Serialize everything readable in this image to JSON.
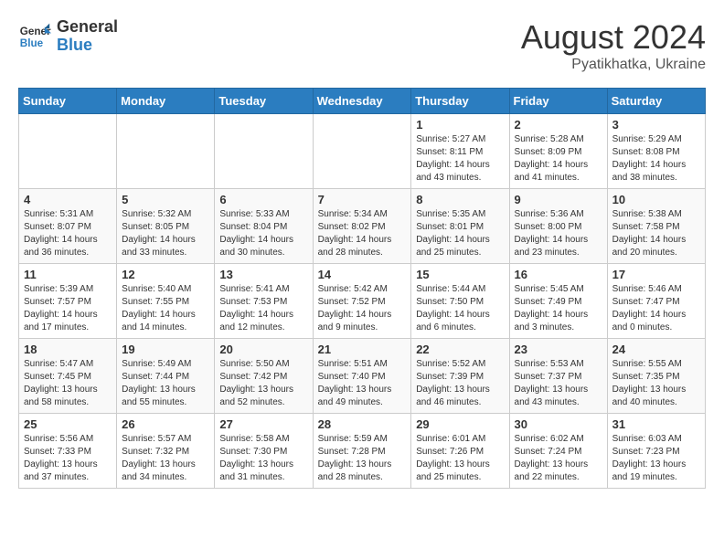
{
  "header": {
    "logo_general": "General",
    "logo_blue": "Blue",
    "month_year": "August 2024",
    "location": "Pyatikhatka, Ukraine"
  },
  "weekdays": [
    "Sunday",
    "Monday",
    "Tuesday",
    "Wednesday",
    "Thursday",
    "Friday",
    "Saturday"
  ],
  "weeks": [
    [
      {
        "day": "",
        "info": ""
      },
      {
        "day": "",
        "info": ""
      },
      {
        "day": "",
        "info": ""
      },
      {
        "day": "",
        "info": ""
      },
      {
        "day": "1",
        "info": "Sunrise: 5:27 AM\nSunset: 8:11 PM\nDaylight: 14 hours\nand 43 minutes."
      },
      {
        "day": "2",
        "info": "Sunrise: 5:28 AM\nSunset: 8:09 PM\nDaylight: 14 hours\nand 41 minutes."
      },
      {
        "day": "3",
        "info": "Sunrise: 5:29 AM\nSunset: 8:08 PM\nDaylight: 14 hours\nand 38 minutes."
      }
    ],
    [
      {
        "day": "4",
        "info": "Sunrise: 5:31 AM\nSunset: 8:07 PM\nDaylight: 14 hours\nand 36 minutes."
      },
      {
        "day": "5",
        "info": "Sunrise: 5:32 AM\nSunset: 8:05 PM\nDaylight: 14 hours\nand 33 minutes."
      },
      {
        "day": "6",
        "info": "Sunrise: 5:33 AM\nSunset: 8:04 PM\nDaylight: 14 hours\nand 30 minutes."
      },
      {
        "day": "7",
        "info": "Sunrise: 5:34 AM\nSunset: 8:02 PM\nDaylight: 14 hours\nand 28 minutes."
      },
      {
        "day": "8",
        "info": "Sunrise: 5:35 AM\nSunset: 8:01 PM\nDaylight: 14 hours\nand 25 minutes."
      },
      {
        "day": "9",
        "info": "Sunrise: 5:36 AM\nSunset: 8:00 PM\nDaylight: 14 hours\nand 23 minutes."
      },
      {
        "day": "10",
        "info": "Sunrise: 5:38 AM\nSunset: 7:58 PM\nDaylight: 14 hours\nand 20 minutes."
      }
    ],
    [
      {
        "day": "11",
        "info": "Sunrise: 5:39 AM\nSunset: 7:57 PM\nDaylight: 14 hours\nand 17 minutes."
      },
      {
        "day": "12",
        "info": "Sunrise: 5:40 AM\nSunset: 7:55 PM\nDaylight: 14 hours\nand 14 minutes."
      },
      {
        "day": "13",
        "info": "Sunrise: 5:41 AM\nSunset: 7:53 PM\nDaylight: 14 hours\nand 12 minutes."
      },
      {
        "day": "14",
        "info": "Sunrise: 5:42 AM\nSunset: 7:52 PM\nDaylight: 14 hours\nand 9 minutes."
      },
      {
        "day": "15",
        "info": "Sunrise: 5:44 AM\nSunset: 7:50 PM\nDaylight: 14 hours\nand 6 minutes."
      },
      {
        "day": "16",
        "info": "Sunrise: 5:45 AM\nSunset: 7:49 PM\nDaylight: 14 hours\nand 3 minutes."
      },
      {
        "day": "17",
        "info": "Sunrise: 5:46 AM\nSunset: 7:47 PM\nDaylight: 14 hours\nand 0 minutes."
      }
    ],
    [
      {
        "day": "18",
        "info": "Sunrise: 5:47 AM\nSunset: 7:45 PM\nDaylight: 13 hours\nand 58 minutes."
      },
      {
        "day": "19",
        "info": "Sunrise: 5:49 AM\nSunset: 7:44 PM\nDaylight: 13 hours\nand 55 minutes."
      },
      {
        "day": "20",
        "info": "Sunrise: 5:50 AM\nSunset: 7:42 PM\nDaylight: 13 hours\nand 52 minutes."
      },
      {
        "day": "21",
        "info": "Sunrise: 5:51 AM\nSunset: 7:40 PM\nDaylight: 13 hours\nand 49 minutes."
      },
      {
        "day": "22",
        "info": "Sunrise: 5:52 AM\nSunset: 7:39 PM\nDaylight: 13 hours\nand 46 minutes."
      },
      {
        "day": "23",
        "info": "Sunrise: 5:53 AM\nSunset: 7:37 PM\nDaylight: 13 hours\nand 43 minutes."
      },
      {
        "day": "24",
        "info": "Sunrise: 5:55 AM\nSunset: 7:35 PM\nDaylight: 13 hours\nand 40 minutes."
      }
    ],
    [
      {
        "day": "25",
        "info": "Sunrise: 5:56 AM\nSunset: 7:33 PM\nDaylight: 13 hours\nand 37 minutes."
      },
      {
        "day": "26",
        "info": "Sunrise: 5:57 AM\nSunset: 7:32 PM\nDaylight: 13 hours\nand 34 minutes."
      },
      {
        "day": "27",
        "info": "Sunrise: 5:58 AM\nSunset: 7:30 PM\nDaylight: 13 hours\nand 31 minutes."
      },
      {
        "day": "28",
        "info": "Sunrise: 5:59 AM\nSunset: 7:28 PM\nDaylight: 13 hours\nand 28 minutes."
      },
      {
        "day": "29",
        "info": "Sunrise: 6:01 AM\nSunset: 7:26 PM\nDaylight: 13 hours\nand 25 minutes."
      },
      {
        "day": "30",
        "info": "Sunrise: 6:02 AM\nSunset: 7:24 PM\nDaylight: 13 hours\nand 22 minutes."
      },
      {
        "day": "31",
        "info": "Sunrise: 6:03 AM\nSunset: 7:23 PM\nDaylight: 13 hours\nand 19 minutes."
      }
    ]
  ]
}
